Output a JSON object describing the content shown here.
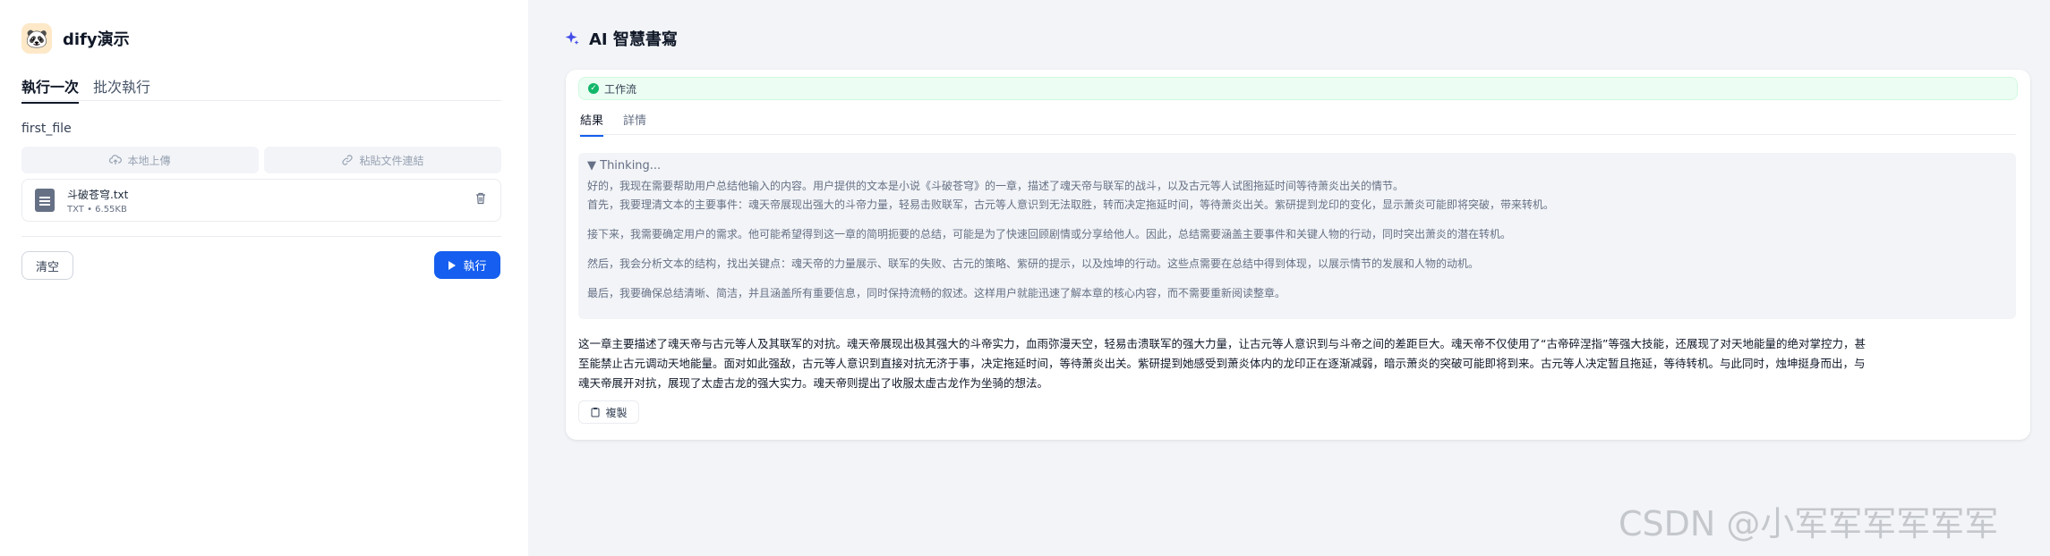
{
  "app": {
    "name": "dify演示"
  },
  "tabs": {
    "run_once": "執行一次",
    "batch_run": "批次執行"
  },
  "form": {
    "field_label": "first_file",
    "local_upload": "本地上傳",
    "paste_link": "粘貼文件連結",
    "file": {
      "name": "斗破苍穹.txt",
      "info": "TXT • 6.55KB"
    },
    "clear_label": "清空",
    "run_label": "執行"
  },
  "result_panel": {
    "title": "AI 智慧書寫",
    "workflow_label": "工作流",
    "tabs": {
      "result": "結果",
      "detail": "詳情"
    },
    "thinking_title": "▼ Thinking...",
    "thinking_paragraphs": [
      "好的，我现在需要帮助用户总结他输入的内容。用户提供的文本是小说《斗破苍穹》的一章，描述了魂天帝与联军的战斗，以及古元等人试图拖延时间等待萧炎出关的情节。",
      "首先，我要理清文本的主要事件：魂天帝展现出强大的斗帝力量，轻易击败联军，古元等人意识到无法取胜，转而决定拖延时间，等待萧炎出关。紫研提到龙印的变化，显示萧炎可能即将突破，带来转机。",
      "接下来，我需要确定用户的需求。他可能希望得到这一章的简明扼要的总结，可能是为了快速回顾剧情或分享给他人。因此，总结需要涵盖主要事件和关键人物的行动，同时突出萧炎的潜在转机。",
      "然后，我会分析文本的结构，找出关键点：魂天帝的力量展示、联军的失败、古元的策略、紫研的提示，以及烛坤的行动。这些点需要在总结中得到体现，以展示情节的发展和人物的动机。",
      "最后，我要确保总结清晰、简洁，并且涵盖所有重要信息，同时保持流畅的叙述。这样用户就能迅速了解本章的核心内容，而不需要重新阅读整章。"
    ],
    "answer_lines": [
      "这一章主要描述了魂天帝与古元等人及其联军的对抗。魂天帝展现出极其强大的斗帝实力，血雨弥漫天空，轻易击溃联军的强大力量，让古元等人意识到与斗帝之间的差距巨大。魂天帝不仅使用了“古帝碎涅指”等强大技能，还展现了对天地能量的绝对掌控力，甚",
      "至能禁止古元调动天地能量。面对如此强敌，古元等人意识到直接对抗无济于事，决定拖延时间，等待萧炎出关。紫研提到她感受到萧炎体内的龙印正在逐渐减弱，暗示萧炎的突破可能即将到来。古元等人决定暂且拖延，等待转机。与此同时，烛坤挺身而出，与",
      "魂天帝展开对抗，展现了太虚古龙的强大实力。魂天帝则提出了收服太虚古龙作为坐骑的想法。"
    ],
    "copy_label": "複製"
  },
  "watermark": "CSDN @小军军军军军军",
  "colors": {
    "primary": "#155eef",
    "success": "#12b76a",
    "sidebar_bg": "#ffffff",
    "main_bg": "#f2f4f7"
  }
}
